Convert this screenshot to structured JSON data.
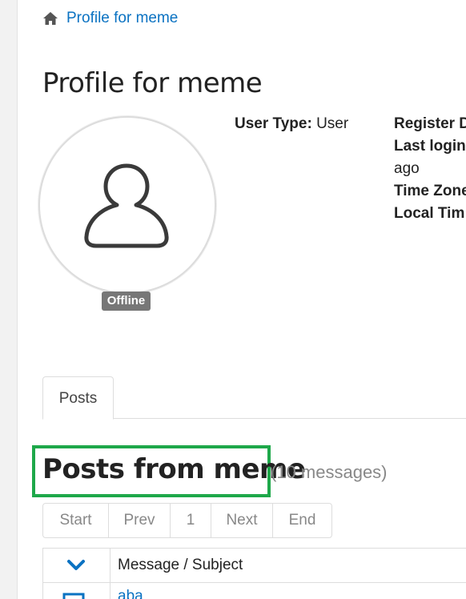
{
  "breadcrumb": {
    "label": "Profile for meme",
    "icon": "home-icon"
  },
  "page_title": "Profile for meme",
  "avatar": {
    "status": "Offline",
    "icon": "user-silhouette-icon"
  },
  "profile_info": {
    "user_type_label": "User Type:",
    "user_type_value": "User",
    "register_label": "Register D",
    "last_login_label": "Last login",
    "last_login_value": "ago",
    "time_zone_label": "Time Zone",
    "local_time_label": "Local Tim"
  },
  "tabs": [
    {
      "label": "Posts",
      "active": true
    }
  ],
  "posts": {
    "heading": "Posts from meme",
    "count": "(10 messages)"
  },
  "pager": {
    "start": "Start",
    "prev": "Prev",
    "page": "1",
    "next": "Next",
    "end": "End"
  },
  "table": {
    "column_subject": "Message / Subject",
    "rows": [
      {
        "subject": "aba"
      }
    ]
  },
  "colors": {
    "link": "#0a72c2",
    "highlight": "#1ea84a",
    "badge": "#777777"
  }
}
